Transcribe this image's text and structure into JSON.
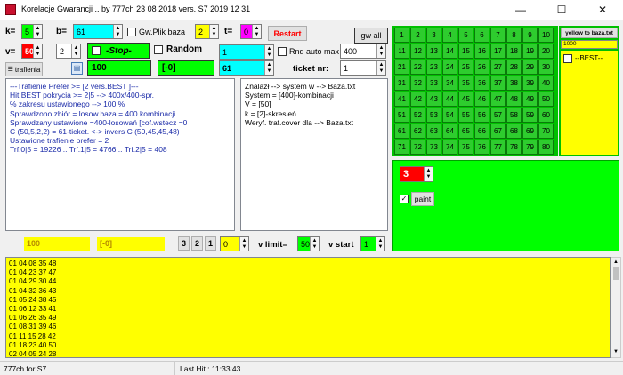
{
  "window": {
    "title": "Korelacje Gwarancji   .. by 777ch   23 08 2018  vers. S7 2019 12 31",
    "minimize": "—",
    "maximize": "☐",
    "close": "✕"
  },
  "row1": {
    "k_label": "k=",
    "k_value": "5",
    "b_label": "b=",
    "b_value": "61",
    "gw_plik_label": "Gw.Plik baza",
    "s_value": "2",
    "t_label": "t=",
    "t_value": "0",
    "restart_label": "Restart",
    "gw_all_label": "gw all"
  },
  "row2": {
    "v_label": "v=",
    "v_value": "50",
    "v2_value": "2",
    "stop_label": "-Stop-",
    "random_label": "Random",
    "cyan_value": "1",
    "rnd_auto_max_label": "Rnd auto max",
    "rnd_auto_max_value": "400"
  },
  "row3": {
    "trafienia_label": "trafienia",
    "green1_value": "100",
    "green2_value": "[-0]",
    "cyan2_value": "61",
    "ticket_label": "ticket nr:",
    "ticket_value": "1"
  },
  "left_memo": [
    "---Trafienie Prefer >= [2   vers.BEST ]---",
    "Hit BEST pokrycia >= 2|5 --> 400x/400-spr.",
    "% zakresu ustawionego --> 100 %",
    "Sprawdzono zbiór = losow.baza = 400 kombinacji",
    "Sprawdzany ustawione =400-losowań [cof.wstecz =0",
    "C (50,5,2,2) = 61-ticket.   <-> invers C (50,45,45,48)",
    "Ustawione trafienie prefer = 2",
    "Trf.0|5 = 19226 .. Trf.1|5 = 4766 .. Trf.2|5 = 408"
  ],
  "right_memo": [
    "Znalazł --> system w --> Baza.txt",
    "System = [400]-kombinacji",
    "V = [50]",
    "k = [2]-skresleń",
    "Weryf. traf.cover dla --> Baza.txt"
  ],
  "numbers": [
    "1",
    "2",
    "3",
    "4",
    "5",
    "6",
    "7",
    "8",
    "9",
    "10",
    "11",
    "12",
    "13",
    "14",
    "15",
    "16",
    "17",
    "18",
    "19",
    "20",
    "21",
    "22",
    "23",
    "24",
    "25",
    "26",
    "27",
    "28",
    "29",
    "30",
    "31",
    "32",
    "33",
    "34",
    "35",
    "36",
    "37",
    "38",
    "39",
    "40",
    "41",
    "42",
    "43",
    "44",
    "45",
    "46",
    "47",
    "48",
    "49",
    "50",
    "51",
    "52",
    "53",
    "54",
    "55",
    "56",
    "57",
    "58",
    "59",
    "60",
    "61",
    "62",
    "63",
    "64",
    "65",
    "66",
    "67",
    "68",
    "69",
    "70",
    "71",
    "72",
    "73",
    "74",
    "75",
    "76",
    "77",
    "78",
    "79",
    "80"
  ],
  "side_panel": {
    "yellow_to_baza_label": "yellow to baza.txt",
    "input_value": "1000",
    "best_label": "--BEST--"
  },
  "green_panel": {
    "spin_value": "3",
    "paint_label": "paint"
  },
  "bottom_row": {
    "val1": "100",
    "val2": "[-0]",
    "n3": "3",
    "n2": "2",
    "n1": "1",
    "spin0": "0",
    "v_limit_label": "v limit=",
    "v_limit_value": "50",
    "v_start_label": "v start",
    "v_start_value": "1"
  },
  "results": [
    "01 04 08 35 48",
    "01 04 23 37 47",
    "01 04 29 30 44",
    "01 04 32 36 43",
    "01 05 24 38 45",
    "01 06 12 33 41",
    "01 06 26 35 49",
    "01 08 31 39 46",
    "01 11 15 28 42",
    "01 18 23 40 50",
    "02 04 05 24 28"
  ],
  "status": {
    "left": "777ch for S7",
    "right": "Last Hit : 11:33:43"
  },
  "colors": {
    "accent_green": "#00ff00",
    "cyan": "#00ffff",
    "yellow": "#ffff00",
    "magenta": "#ff00ff",
    "red": "#ff0000"
  }
}
